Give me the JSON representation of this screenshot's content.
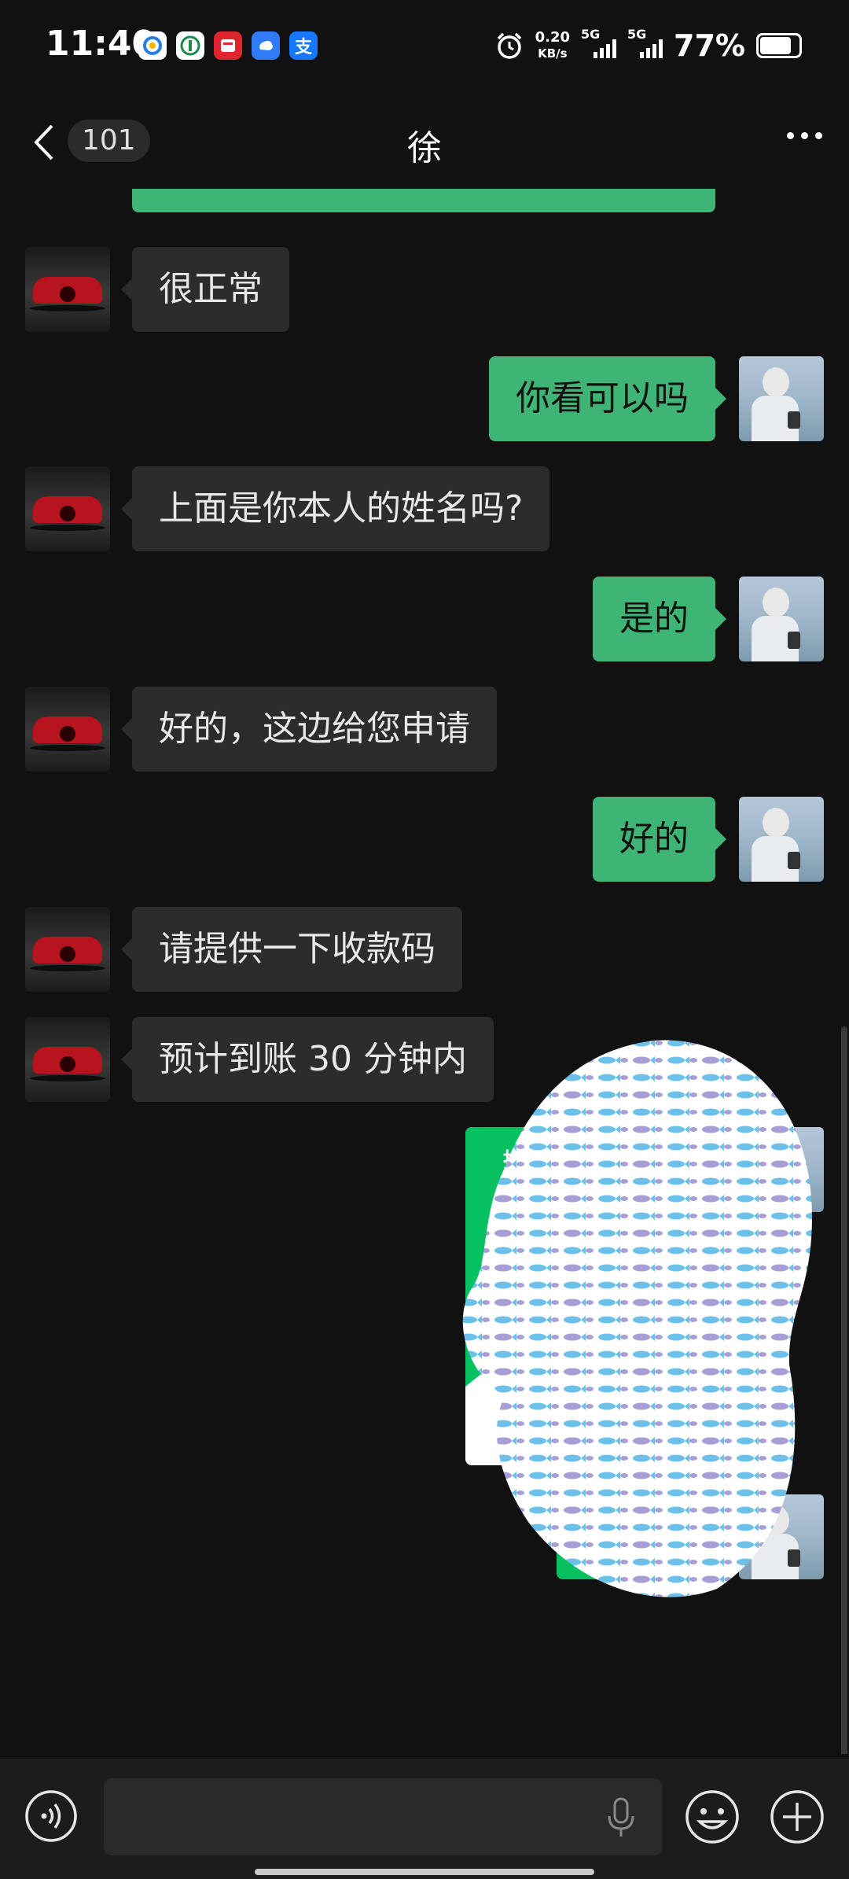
{
  "status_bar": {
    "time": "11:40",
    "net_speed_value": "0.20",
    "net_speed_unit": "KB/s",
    "signal1_label": "5G",
    "signal2_label": "5G",
    "battery": "77%",
    "notif_alipay": "支"
  },
  "header": {
    "unread_count": "101",
    "title": "徐"
  },
  "messages": [
    {
      "side": "in",
      "text": "很正常"
    },
    {
      "side": "out",
      "text": "你看可以吗"
    },
    {
      "side": "in",
      "text": "上面是你本人的姓名吗?"
    },
    {
      "side": "out",
      "text": "是的"
    },
    {
      "side": "in",
      "text": "好的，这边给您申请"
    },
    {
      "side": "out",
      "text": "好的"
    },
    {
      "side": "in",
      "text": "请提供一下收款码"
    },
    {
      "side": "in",
      "text": "预计到账 30 分钟内"
    }
  ],
  "card": {
    "label": "推荐"
  },
  "input_bar": {
    "placeholder": ""
  },
  "colors": {
    "background": "#111111",
    "incoming_bubble": "#2c2c2c",
    "outgoing_bubble": "#3eb575",
    "wechat_green": "#07c160"
  }
}
